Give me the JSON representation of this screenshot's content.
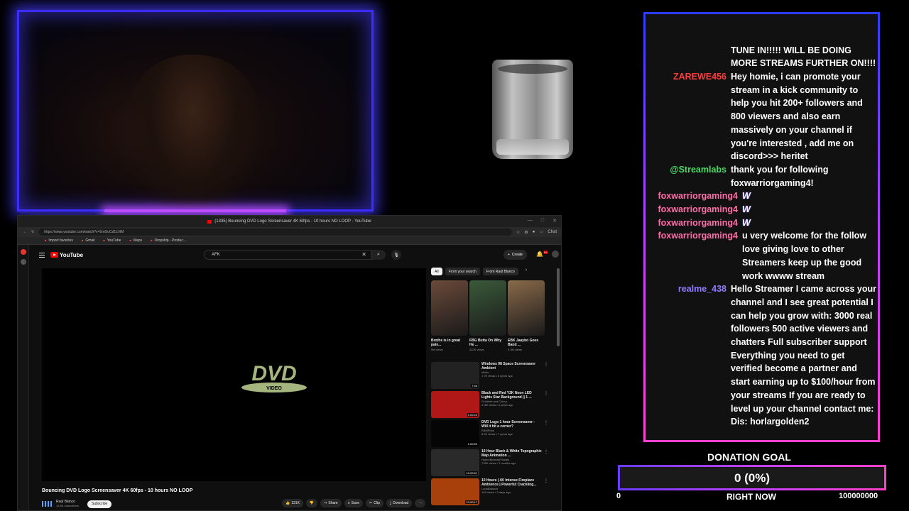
{
  "browser": {
    "window_title": "(1335) Bouncing DVD Logo Screensaver 4K 60fps - 10 hours NO LOOP - YouTube",
    "url": "https://www.youtube.com/watch?v=5mGuCdCcNM",
    "bookmarks": [
      "Import favorites",
      "Gmail",
      "YouTube",
      "Maps",
      "Dropship - Produc..."
    ],
    "profile_label": "Chat"
  },
  "youtube": {
    "logo_text": "YouTube",
    "search_value": "AFK",
    "create_label": "Create",
    "notification_count": "9+",
    "video_title": "Bouncing DVD Logo Screensaver 4K 60fps - 10 hours NO LOOP",
    "channel_name": "Raúl Blanco",
    "subscribers": "12.8K subscribers",
    "subscribe_label": "Subscribe",
    "like_count": "131K",
    "actions": [
      "Share",
      "Save",
      "Clip",
      "Download"
    ],
    "chips": [
      "All",
      "From your search",
      "From Raúl Blanco"
    ],
    "shorts": [
      {
        "title": "Brothe is in great pain...",
        "views": "9M views",
        "color": "#6b4a3a"
      },
      {
        "title": "FBG Butta On Why He ...",
        "views": "322K views",
        "color": "#3a5a3a"
      },
      {
        "title": "EBK Jaaybo Goes Band ...",
        "views": "9.3M views",
        "color": "#8a6a4a"
      }
    ],
    "recommendations": [
      {
        "title": "Windows 98 Space Screensaver Ambient",
        "channel": "Mictio",
        "stats": "1.7K views • 6 years ago",
        "duration": "7:58",
        "color": "#222"
      },
      {
        "title": "Black and Red Y2K Neon LED Lights Star Background || 1 ...",
        "channel": "Gradient and Colour",
        "stats": "2.9M views • 3 years ago",
        "duration": "1:00:23",
        "color": "#b01818"
      },
      {
        "title": "DVD Logo 1 hour Screensaver - Will it hit a corner?",
        "channel": "EBMPobe",
        "stats": "8.2K views • 7 years ago",
        "duration": "1:00:59",
        "color": "#050505"
      },
      {
        "title": "10 Hour Black & White Topographic Map Animation ...",
        "channel": "HypnoBinauralVisuals",
        "stats": "739K views • 7 months ago",
        "duration": "10:20:51",
        "color": "#2a2a2a"
      },
      {
        "title": "10 Hours | 4K Intense Fireplace Ambience | Powerful Crackling...",
        "channel": "LunaBalance",
        "stats": "145 views • 3 days ago",
        "duration": "10:00:17",
        "color": "#a8400c"
      }
    ]
  },
  "chat": {
    "name_colors": {
      "ZAREWE456": "#ff3b3b",
      "@Streamlabs": "#4cd964",
      "foxwarriorgaming4": "#ff6ea8",
      "realme_438": "#8f7bff"
    },
    "messages": [
      {
        "name": "",
        "text": "TUNE IN!!!!! WILL BE DOING MORE STREAMS FURTHER ON!!!!",
        "color": "#ffffff"
      },
      {
        "name": "ZAREWE456",
        "text": "Hey homie, i can promote your stream in a kick community to help you hit 200+ followers and 800 viewers and also earn massively on your channel if you're interested , add me on discord>>> heritet",
        "color": "#ff3b3b"
      },
      {
        "name": "@Streamlabs",
        "text": "thank you for following foxwarriorgaming4!",
        "color": "#4cd964"
      },
      {
        "name": "foxwarriorgaming4",
        "text": "W",
        "color": "#ff6ea8",
        "badge": true
      },
      {
        "name": "foxwarriorgaming4",
        "text": "W",
        "color": "#ff6ea8",
        "badge": true
      },
      {
        "name": "foxwarriorgaming4",
        "text": "W",
        "color": "#ff6ea8",
        "badge": true
      },
      {
        "name": "foxwarriorgaming4",
        "text": "u very welcome for the follow love giving love to other Streamers keep up the good work wwww stream",
        "color": "#ff6ea8"
      },
      {
        "name": "realme_438",
        "text": "Hello Streamer I came across your channel and I see great potential I can help you grow with: 3000 real followers 500 active viewers and chatters Full subscriber support Everything you need to get verified become a partner and start earning up to $100/hour from your streams If you are ready to level up your channel contact me: Dis: horlargolden2",
        "color": "#8f7bff"
      }
    ]
  },
  "donation": {
    "title": "DONATION GOAL",
    "value_text": "0 (0%)",
    "progress_fraction": 0,
    "min_label": "0",
    "status_label": "RIGHT NOW",
    "max_label": "100000000"
  }
}
